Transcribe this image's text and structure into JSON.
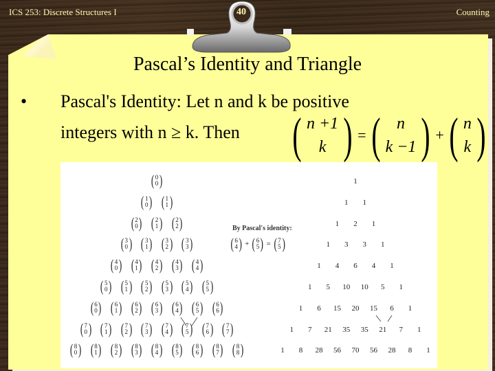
{
  "header": {
    "course": "ICS 253: Discrete Structures I",
    "slide_number": "40",
    "section": "Counting"
  },
  "slide": {
    "title": "Pascal’s Identity and Triangle",
    "bullet": {
      "marker": "•",
      "line1": "Pascal's Identity: Let n and k be positive",
      "line2": "integers with n ≥ k. Then"
    },
    "formula": {
      "lhs": {
        "top": "n +1",
        "bottom": "k"
      },
      "eq": "=",
      "term1": {
        "top": "n",
        "bottom": "k −1"
      },
      "plus": "+",
      "term2": {
        "top": "n",
        "bottom": "k"
      }
    }
  },
  "figure": {
    "identity_label": "By Pascal's identity:",
    "identity_example": {
      "a": [
        "6",
        "4"
      ],
      "plus": "+",
      "b": [
        "6",
        "5"
      ],
      "eq": "=",
      "c": [
        "7",
        "5"
      ]
    },
    "binomial_rows": [
      [
        [
          "0",
          "0"
        ]
      ],
      [
        [
          "1",
          "0"
        ],
        [
          "1",
          "1"
        ]
      ],
      [
        [
          "2",
          "0"
        ],
        [
          "2",
          "1"
        ],
        [
          "2",
          "2"
        ]
      ],
      [
        [
          "3",
          "0"
        ],
        [
          "3",
          "1"
        ],
        [
          "3",
          "2"
        ],
        [
          "3",
          "3"
        ]
      ],
      [
        [
          "4",
          "0"
        ],
        [
          "4",
          "1"
        ],
        [
          "4",
          "2"
        ],
        [
          "4",
          "3"
        ],
        [
          "4",
          "4"
        ]
      ],
      [
        [
          "5",
          "0"
        ],
        [
          "5",
          "1"
        ],
        [
          "5",
          "2"
        ],
        [
          "5",
          "3"
        ],
        [
          "5",
          "4"
        ],
        [
          "5",
          "5"
        ]
      ],
      [
        [
          "6",
          "0"
        ],
        [
          "6",
          "1"
        ],
        [
          "6",
          "2"
        ],
        [
          "6",
          "3"
        ],
        [
          "6",
          "4"
        ],
        [
          "6",
          "5"
        ],
        [
          "6",
          "6"
        ]
      ],
      [
        [
          "7",
          "0"
        ],
        [
          "7",
          "1"
        ],
        [
          "7",
          "2"
        ],
        [
          "7",
          "3"
        ],
        [
          "7",
          "4"
        ],
        [
          "7",
          "5"
        ],
        [
          "7",
          "6"
        ],
        [
          "7",
          "7"
        ]
      ],
      [
        [
          "8",
          "0"
        ],
        [
          "8",
          "1"
        ],
        [
          "8",
          "2"
        ],
        [
          "8",
          "3"
        ],
        [
          "8",
          "4"
        ],
        [
          "8",
          "5"
        ],
        [
          "8",
          "6"
        ],
        [
          "8",
          "7"
        ],
        [
          "8",
          "8"
        ]
      ]
    ],
    "numeric_rows": [
      [
        "1"
      ],
      [
        "1",
        "1"
      ],
      [
        "1",
        "2",
        "1"
      ],
      [
        "1",
        "3",
        "3",
        "1"
      ],
      [
        "1",
        "4",
        "6",
        "4",
        "1"
      ],
      [
        "1",
        "5",
        "10",
        "10",
        "5",
        "1"
      ],
      [
        "1",
        "6",
        "15",
        "20",
        "15",
        "6",
        "1"
      ],
      [
        "1",
        "7",
        "21",
        "35",
        "35",
        "21",
        "7",
        "1"
      ],
      [
        "1",
        "8",
        "28",
        "56",
        "70",
        "56",
        "28",
        "8",
        "1"
      ]
    ]
  }
}
